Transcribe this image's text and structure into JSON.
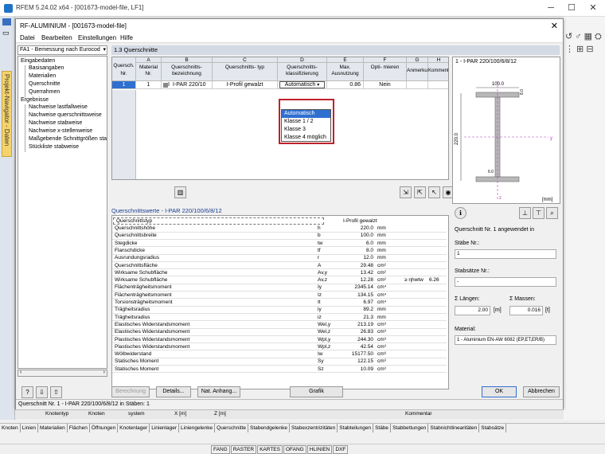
{
  "app": {
    "title": "RFEM 5.24.02 x64 - [001673-model-file, LF1]"
  },
  "dialog": {
    "title": "RF-ALUMINIUM - [001673-model-file]",
    "menu": [
      "Datei",
      "Bearbeiten",
      "Einstellungen",
      "Hilfe"
    ],
    "module": "FA1 - Bemessung nach Eurocod",
    "section_title": "1.3 Querschnitte"
  },
  "nav_tab": "Projekt-Navigator - Daten",
  "tree": {
    "g1": "Eingabedaten",
    "g1_items": [
      "Basisangaben",
      "Materialien",
      "Querschnitte",
      "Querrahmen"
    ],
    "g2": "Ergebnisse",
    "g2_items": [
      "Nachweise lastfallweise",
      "Nachweise querschnittsweise",
      "Nachweise stabweise",
      "Nachweise x-stellenweise",
      "Maßgebende Schnittgrößen sta",
      "Stückliste stabweise"
    ]
  },
  "grid": {
    "letters": [
      "A",
      "B",
      "C",
      "D",
      "E",
      "F",
      "G",
      "H"
    ],
    "headers": [
      "Quersch. Nr.",
      "Material Nr.",
      "Querschnitts- bezeichnung",
      "Querschnitts- typ",
      "Querschnitts- klassifizierung",
      "Max. Ausnutzung",
      "Opti- mieren",
      "Anmerku",
      "Kommentar"
    ],
    "row": {
      "nr": "1",
      "mat": "1",
      "name": "I-PAR 220/10",
      "type": "I-Profil gewalzt",
      "class": "Automatisch",
      "util": "0.86",
      "opt": "Nein"
    },
    "dropdown": [
      "Automatisch",
      "Klasse 1 / 2",
      "Klasse 3",
      "Klasse 4 möglich"
    ]
  },
  "props": {
    "title": "Querschnittswerte - I-PAR 220/100/6/8/12",
    "head": {
      "label": "Querschnittstyp",
      "value": "I-Profil gewalzt"
    },
    "rows": [
      {
        "l": "Querschnittshöhe",
        "s": "h",
        "v": "220.0",
        "u": "mm"
      },
      {
        "l": "Querschnittsbreite",
        "s": "b",
        "v": "100.0",
        "u": "mm"
      },
      {
        "l": "Stegdicke",
        "s": "tw",
        "v": "6.0",
        "u": "mm"
      },
      {
        "l": "Flanschdicke",
        "s": "tf",
        "v": "8.0",
        "u": "mm"
      },
      {
        "l": "Ausrundungsradius",
        "s": "r",
        "v": "12.0",
        "u": "mm"
      },
      {
        "l": "Querschnittsfläche",
        "s": "A",
        "v": "29.48",
        "u": "cm²"
      },
      {
        "l": "Wirksame Schubfläche",
        "s": "Av,y",
        "v": "13.42",
        "u": "cm²"
      },
      {
        "l": "Wirksame Schubfläche",
        "s": "Av,z",
        "v": "12.28",
        "u": "cm²",
        "x": "≥ ηhwtw",
        "y": "6.26"
      },
      {
        "l": "Flächenträgheitsmoment",
        "s": "Iy",
        "v": "2345.14",
        "u": "cm⁴"
      },
      {
        "l": "Flächenträgheitsmoment",
        "s": "Iz",
        "v": "134.15",
        "u": "cm⁴"
      },
      {
        "l": "Torsionsträgheitsmoment",
        "s": "It",
        "v": "6.97",
        "u": "cm⁴"
      },
      {
        "l": "Trägheitsradius",
        "s": "iy",
        "v": "89.2",
        "u": "mm"
      },
      {
        "l": "Trägheitsradius",
        "s": "iz",
        "v": "21.3",
        "u": "mm"
      },
      {
        "l": "Elastisches Widerstandsmoment",
        "s": "Wel,y",
        "v": "213.19",
        "u": "cm³"
      },
      {
        "l": "Elastisches Widerstandsmoment",
        "s": "Wel,z",
        "v": "26.83",
        "u": "cm³"
      },
      {
        "l": "Plastisches Widerstandsmoment",
        "s": "Wpl,y",
        "v": "244.30",
        "u": "cm³"
      },
      {
        "l": "Plastisches Widerstandsmoment",
        "s": "Wpl,z",
        "v": "42.54",
        "u": "cm³"
      },
      {
        "l": "Wölbwiderstand",
        "s": "Iw",
        "v": "15177.50",
        "u": "cm⁶"
      },
      {
        "l": "Statisches Moment",
        "s": "Sy",
        "v": "122.15",
        "u": "cm³"
      },
      {
        "l": "Statisches Moment",
        "s": "Sz",
        "v": "10.09",
        "u": "cm³"
      }
    ]
  },
  "preview": {
    "title": "1 - I-PAR 220/100/6/8/12",
    "dim_top": "100.0",
    "dim_left": "220.0",
    "dim_web": "6.0",
    "dim_fl": "8.0",
    "unit": "[mm]",
    "axis_y": "y",
    "axis_z": "z"
  },
  "info": {
    "applied": "Querschnitt Nr. 1 angewendet in",
    "staebe_label": "Stäbe Nr.:",
    "staebe_val": "1",
    "saetze_label": "Stabsätze Nr.:",
    "saetze_val": "-",
    "laengen_label": "Σ Längen:",
    "laengen_val": "2.00",
    "laengen_u": "[m]",
    "massen_label": "Σ Massen:",
    "massen_val": "0.016",
    "massen_u": "[t]",
    "material_label": "Material:",
    "material_val": "1 - Aluminium EN-AW 6082 (EP,ET,ER/B)"
  },
  "buttons": {
    "berechnung": "Berechnung",
    "details": "Details...",
    "anhang": "Nat. Anhang...",
    "grafik": "Grafik",
    "ok": "OK",
    "abbrechen": "Abbrechen"
  },
  "status": "Querschnitt Nr. 1 - I-PAR 220/100/6/8/12 in Stäben: 1",
  "bg_table": [
    "Knotentyp",
    "Knoten",
    "system",
    "X [m]",
    "Z [m]",
    "Kommentar"
  ],
  "tabs": [
    "Knoten",
    "Linien",
    "Materialien",
    "Flächen",
    "Öffnungen",
    "Knotenlager",
    "Linienlager",
    "Liniengelenke",
    "Querschnitte",
    "Stabendgelenke",
    "Stabexzentrizitäten",
    "Stabteilungen",
    "Stäbe",
    "Stabbettungen",
    "Stabnichtlinearitäten",
    "Stabsätze"
  ],
  "statusbar": [
    "FANG",
    "RASTER",
    "KARTES",
    "OFANG",
    "HLINIEN",
    "DXF"
  ]
}
